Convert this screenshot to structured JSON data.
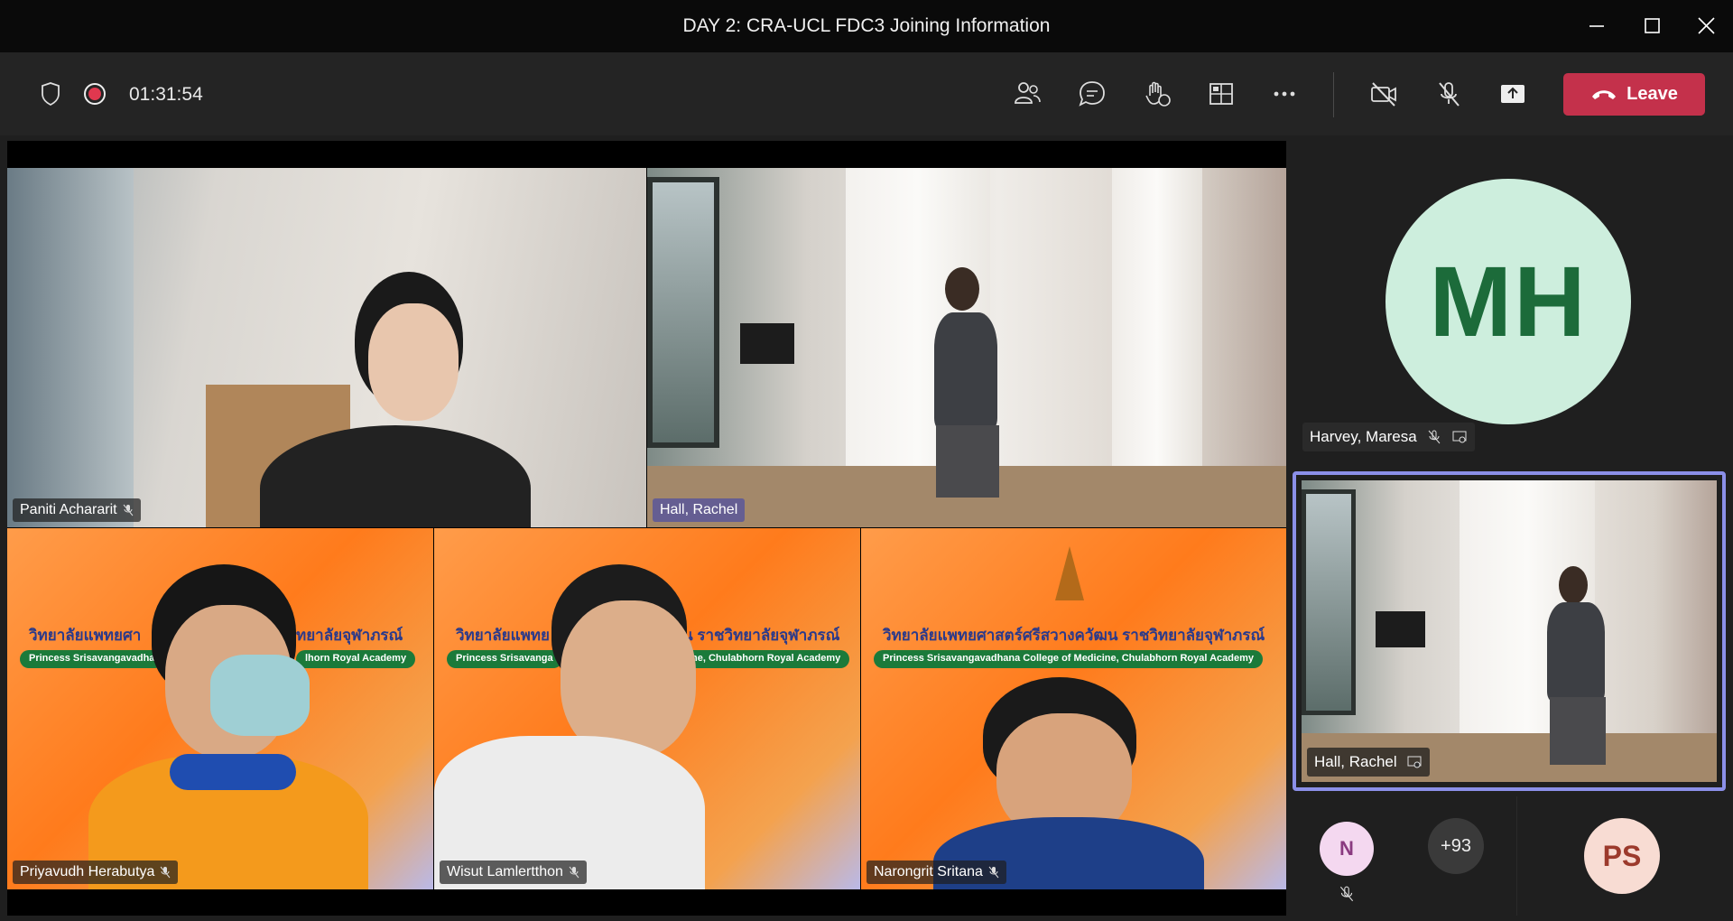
{
  "window": {
    "title": "DAY 2: CRA-UCL FDC3 Joining Information",
    "minimize_icon": "minimize-icon",
    "maximize_icon": "maximize-icon",
    "close_icon": "close-icon"
  },
  "toolbar": {
    "timer": "01:31:54",
    "leave_label": "Leave",
    "icons": [
      "shield-icon",
      "recording-icon",
      "people-icon",
      "chat-icon",
      "reactions-icon",
      "rooms-icon",
      "more-icon",
      "camera-off-icon",
      "mic-off-icon",
      "share-icon"
    ],
    "leave_color": "#c4314b"
  },
  "stage": {
    "tiles": [
      {
        "name": "Paniti Achararit"
      },
      {
        "name": "Hall, Rachel"
      },
      {
        "name": "Priyavudh Herabutya"
      },
      {
        "name": "Wisut Lamlertthon"
      },
      {
        "name": "Narongrit Sritana"
      }
    ],
    "banner_thai": "วิทยาลัยแพทยศาสตร์ศรีสวางควัฒน ราชวิทยาลัยจุฬาภรณ์",
    "banner_thai_left": "วิทยาลัยแพทยศา",
    "banner_thai_left_tail": "ทยาลัยจุฬาภรณ์",
    "banner_thai_mid": "วิทยาลัยแพทย",
    "banner_thai_mid_tail": "น ราชวิทยาลัยจุฬาภรณ์",
    "banner_en": "Princess Srisavangavadhana College of Medicine, Chulabhorn Royal Academy",
    "banner_en_left_head": "Princess Srisavangavadha",
    "banner_en_left_tail": "lhorn Royal Academy",
    "banner_en_mid_head": "Princess Srisavanga",
    "banner_en_mid_tail": "ne, Chulabhorn Royal Academy",
    "logo_text": "CHULABHORN ROYAL ACADEMY"
  },
  "side": {
    "featured": {
      "initials": "MH",
      "name": "Harvey, Maresa",
      "avatar_bg": "#cdeedd",
      "avatar_fg": "#1c6b3a"
    },
    "pinned": {
      "name": "Hall, Rachel",
      "border": "#8b8fe8"
    },
    "others": [
      {
        "initials": "N",
        "bg": "#f4d8f0",
        "fg": "#8a3a80"
      },
      {
        "label": "+93"
      },
      {
        "initials": "PS",
        "bg": "#f8dcd3",
        "fg": "#9c3a2c"
      }
    ]
  }
}
